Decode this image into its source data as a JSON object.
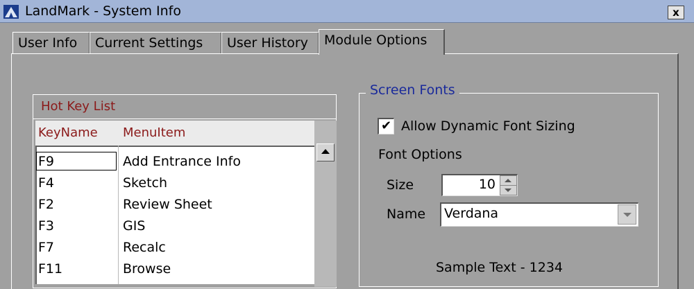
{
  "window": {
    "title": "LandMark - System Info",
    "close_label": "x"
  },
  "tabs": [
    {
      "label": "User Info",
      "active": false
    },
    {
      "label": "Current Settings",
      "active": false
    },
    {
      "label": "User History",
      "active": false
    },
    {
      "label": "Module Options",
      "active": true
    }
  ],
  "hot_keys": {
    "title": "Hot Key List",
    "columns": [
      "KeyName",
      "MenuItem"
    ],
    "rows": [
      {
        "key": "F9",
        "menu": "Add Entrance Info"
      },
      {
        "key": "F4",
        "menu": "Sketch"
      },
      {
        "key": "F2",
        "menu": "Review Sheet"
      },
      {
        "key": "F3",
        "menu": "GIS"
      },
      {
        "key": "F7",
        "menu": "Recalc"
      },
      {
        "key": "F11",
        "menu": "Browse"
      }
    ]
  },
  "screen_fonts": {
    "legend": "Screen Fonts",
    "dynamic_sizing_label": "Allow Dynamic Font Sizing",
    "dynamic_sizing_checked": true,
    "check_mark": "✔",
    "font_options_label": "Font Options",
    "size_label": "Size",
    "size_value": "10",
    "name_label": "Name",
    "name_value": "Verdana",
    "sample_text": "Sample Text - 1234"
  },
  "colors": {
    "titlebar": "#a2b5d8",
    "window_bg": "#a0a0a0",
    "hot_key_text": "#8b1a1a",
    "legend_text": "#1a2a9b"
  }
}
